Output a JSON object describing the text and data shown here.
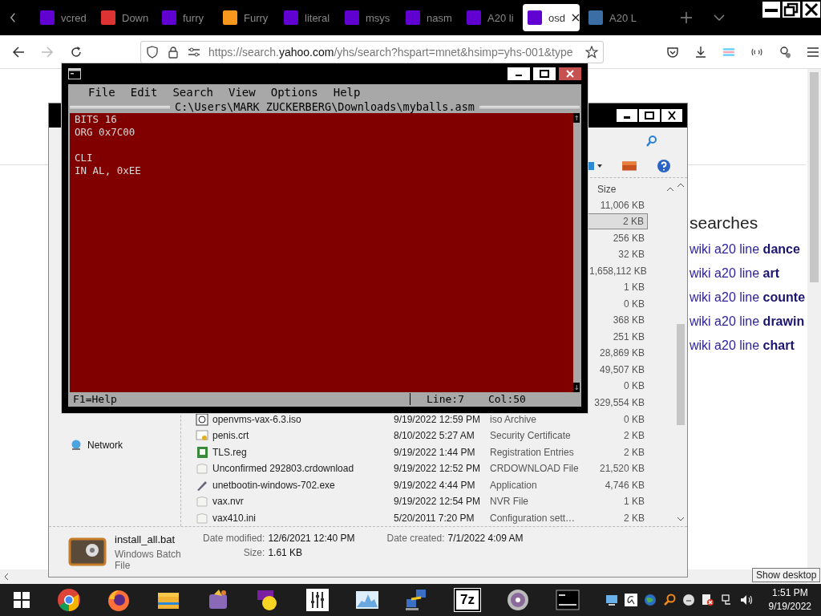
{
  "browser": {
    "tabs": [
      {
        "label": "vcred",
        "selected": false
      },
      {
        "label": "Down",
        "selected": false
      },
      {
        "label": "furry",
        "selected": false
      },
      {
        "label": "Furry",
        "selected": false
      },
      {
        "label": "literal",
        "selected": false
      },
      {
        "label": "msys",
        "selected": false
      },
      {
        "label": "nasm",
        "selected": false
      },
      {
        "label": "A20 li",
        "selected": false
      },
      {
        "label": "osd",
        "selected": true
      },
      {
        "label": "A20 L",
        "selected": false
      }
    ],
    "url": "https://search.**yahoo.com**/yhs/search?hspart=mnet&hsimp=yhs-001&type",
    "page": {
      "heading": "searches",
      "related": [
        "wiki a20 line **dance**",
        "wiki a20 line **art**",
        "wiki a20 line **counte**",
        "wiki a20 line **drawin**",
        "wiki a20 line **chart**"
      ]
    }
  },
  "explorer": {
    "size_header": "Size",
    "nav_item": "Network",
    "rows": [
      {
        "size": "11,006 KB",
        "selected": false
      },
      {
        "size": "2 KB",
        "selected": true
      },
      {
        "size": "256 KB",
        "selected": false
      },
      {
        "size": "32 KB",
        "selected": false
      },
      {
        "size": "1,658,112 KB",
        "selected": false
      },
      {
        "size": "1 KB",
        "selected": false
      },
      {
        "size": "0 KB",
        "selected": false
      },
      {
        "size": "368 KB",
        "selected": false
      },
      {
        "size": "251 KB",
        "selected": false
      },
      {
        "size": "28,869 KB",
        "selected": false
      },
      {
        "size": "49,507 KB",
        "selected": false
      },
      {
        "size": "0 KB",
        "selected": false
      },
      {
        "size": "329,554 KB",
        "selected": false
      },
      {
        "name": "openvms-vax-6.3.iso",
        "date": "9/19/2022 12:59 PM",
        "type": "iso Archive",
        "size": "0 KB",
        "selected": false
      },
      {
        "name": "penis.crt",
        "date": "8/10/2022 5:27 AM",
        "type": "Security Certificate",
        "size": "2 KB",
        "selected": false
      },
      {
        "name": "TLS.reg",
        "date": "9/19/2022 1:44 PM",
        "type": "Registration Entries",
        "size": "2 KB",
        "selected": false
      },
      {
        "name": "Unconfirmed 292803.crdownload",
        "date": "9/19/2022 12:52 PM",
        "type": "CRDOWNLOAD File",
        "size": "21,520 KB",
        "selected": false
      },
      {
        "name": "unetbootin-windows-702.exe",
        "date": "9/19/2022 4:44 PM",
        "type": "Application",
        "size": "4,746 KB",
        "selected": false
      },
      {
        "name": "vax.nvr",
        "date": "9/19/2022 12:54 PM",
        "type": "NVR File",
        "size": "1 KB",
        "selected": false
      },
      {
        "name": "vax410.ini",
        "date": "5/20/2011 7:20 PM",
        "type": "Configuration sett…",
        "size": "2 KB",
        "selected": false
      }
    ],
    "details": {
      "name": "install_all.bat",
      "kind": "Windows Batch File",
      "modified_label": "Date modified:",
      "modified": "12/6/2021 12:40 PM",
      "size_label": "Size:",
      "size": "1.61 KB",
      "created_label": "Date created:",
      "created": "7/1/2022 4:09 AM"
    }
  },
  "editor": {
    "menu": [
      "File",
      "Edit",
      "Search",
      "View",
      "Options",
      "Help"
    ],
    "file_title": "C:\\Users\\MARK ZUCKERBERG\\Downloads\\myballs.asm",
    "blocks": [
      [
        "BITS 16",
        "ORG 0x7C00"
      ],
      [
        "CLI",
        "IN AL, 0xEE"
      ]
    ],
    "scroll_up": "↑",
    "scroll_down": "↓",
    "status": {
      "help": "F1=Help",
      "line": "Line:7",
      "col": "Col:50"
    }
  },
  "tooltip": "Show desktop",
  "taskbar": {
    "seven_zip": "7z",
    "time": "1:51 PM",
    "date": "9/19/2022"
  }
}
